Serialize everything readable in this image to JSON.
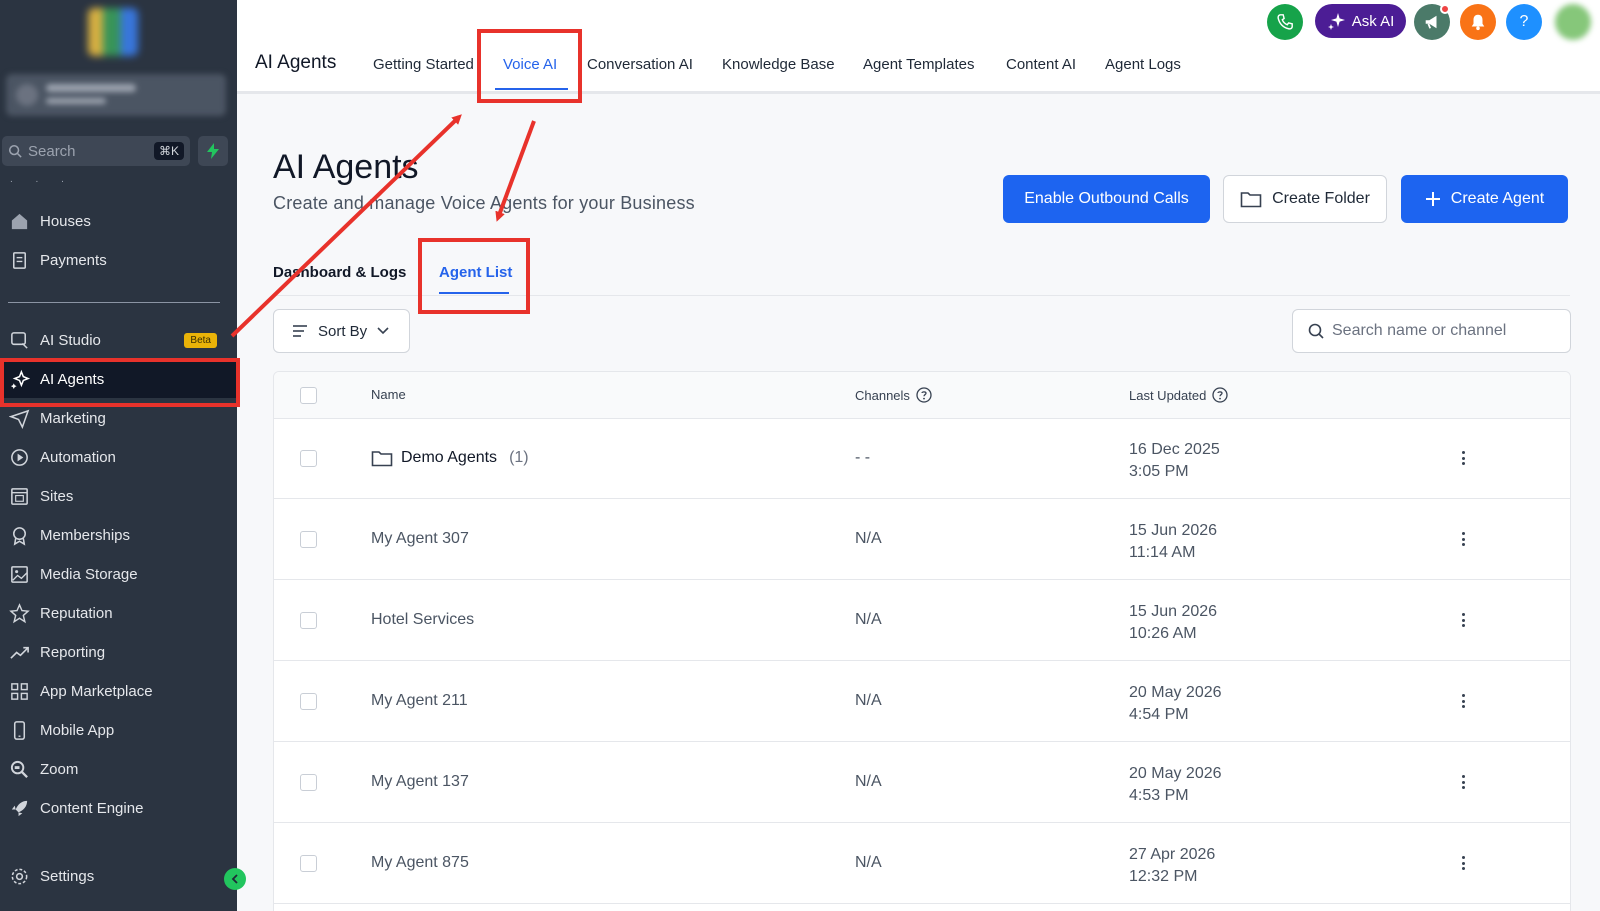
{
  "sidebar": {
    "search_placeholder": "Search",
    "search_shortcut": "⌘K",
    "items": [
      {
        "label": "Houses",
        "icon": "home-icon"
      },
      {
        "label": "Payments",
        "icon": "receipt-icon"
      },
      {
        "label": "AI Studio",
        "icon": "ai-studio-icon",
        "badge": "Beta"
      },
      {
        "label": "AI Agents",
        "icon": "sparkle-icon",
        "active": true
      },
      {
        "label": "Marketing",
        "icon": "send-icon"
      },
      {
        "label": "Automation",
        "icon": "play-circle-icon"
      },
      {
        "label": "Sites",
        "icon": "browser-icon"
      },
      {
        "label": "Memberships",
        "icon": "award-icon"
      },
      {
        "label": "Media Storage",
        "icon": "image-icon"
      },
      {
        "label": "Reputation",
        "icon": "star-icon"
      },
      {
        "label": "Reporting",
        "icon": "trend-icon"
      },
      {
        "label": "App Marketplace",
        "icon": "grid-icon"
      },
      {
        "label": "Mobile App",
        "icon": "phone-icon"
      },
      {
        "label": "Zoom",
        "icon": "zoom-icon"
      },
      {
        "label": "Content Engine",
        "icon": "rocket-icon"
      },
      {
        "label": "Settings",
        "icon": "gear-icon"
      }
    ]
  },
  "header": {
    "title": "AI Agents",
    "tabs": [
      "Getting Started",
      "Voice AI",
      "Conversation AI",
      "Knowledge Base",
      "Agent Templates",
      "Content AI",
      "Agent Logs"
    ],
    "active_tab": "Voice AI",
    "ask_ai_label": "Ask AI",
    "help_label": "?"
  },
  "page": {
    "title": "AI Agents",
    "subtitle": "Create and manage Voice Agents for your Business",
    "buttons": {
      "outbound": "Enable Outbound Calls",
      "folder": "Create Folder",
      "agent": "Create Agent"
    },
    "subtabs": [
      "Dashboard & Logs",
      "Agent List"
    ],
    "active_subtab": "Agent List",
    "sort_label": "Sort By",
    "search_placeholder": "Search name or channel"
  },
  "table": {
    "columns": [
      "Name",
      "Channels",
      "Last Updated"
    ],
    "rows": [
      {
        "name": "Demo Agents",
        "count": "(1)",
        "folder": true,
        "channels": "- -",
        "date": "16 Dec 2025",
        "time": "3:05 PM"
      },
      {
        "name": "My Agent 307",
        "channels": "N/A",
        "date": "15 Jun 2026",
        "time": "11:14 AM"
      },
      {
        "name": "Hotel Services",
        "channels": "N/A",
        "date": "15 Jun 2026",
        "time": "10:26 AM"
      },
      {
        "name": "My Agent 211",
        "channels": "N/A",
        "date": "20 May 2026",
        "time": "4:54 PM"
      },
      {
        "name": "My Agent 137",
        "channels": "N/A",
        "date": "20 May 2026",
        "time": "4:53 PM"
      },
      {
        "name": "My Agent 875",
        "channels": "N/A",
        "date": "27 Apr 2026",
        "time": "12:32 PM"
      }
    ]
  },
  "colors": {
    "sidebar_bg": "#2b3441",
    "accent": "#1d64f0",
    "annotation_red": "#e8322b",
    "beta_badge": "#eab308"
  }
}
